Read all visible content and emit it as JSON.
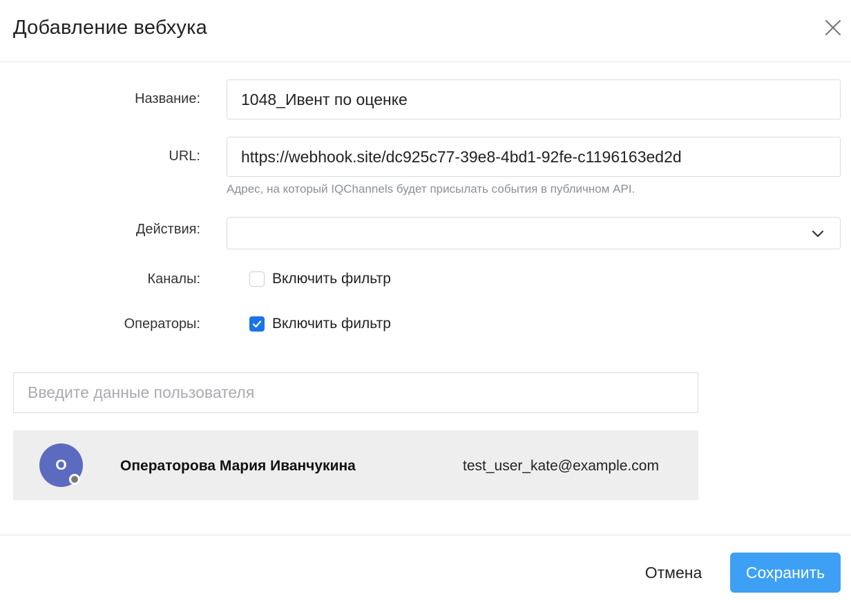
{
  "dialog": {
    "title": "Добавление вебхука",
    "close_icon": "close-icon"
  },
  "form": {
    "name": {
      "label": "Название:",
      "value": "1048_Ивент по оценке"
    },
    "url": {
      "label": "URL:",
      "value": "https://webhook.site/dc925c77-39e8-4bd1-92fe-c1196163ed2d",
      "hint": "Адрес, на который IQChannels будет присылать события в публичном API."
    },
    "actions": {
      "label": "Действия:",
      "selected": "",
      "icon": "chevron-down-icon"
    },
    "channels": {
      "label": "Каналы:",
      "checkbox_label": "Включить фильтр",
      "checked": false
    },
    "operators": {
      "label": "Операторы:",
      "checkbox_label": "Включить фильтр",
      "checked": true
    }
  },
  "user_search": {
    "placeholder": "Введите данные пользователя",
    "value": ""
  },
  "users": [
    {
      "avatar_letter": "О",
      "name": "Операторова Мария Иванчукина",
      "email": "test_user_kate@example.com",
      "status": "offline"
    }
  ],
  "footer": {
    "cancel_label": "Отмена",
    "save_label": "Сохранить"
  },
  "colors": {
    "primary": "#3da0f5",
    "checkbox_checked": "#1a73e8",
    "avatar": "#5c6bc0",
    "row_highlight": "#eeeeee",
    "hint": "#8a8f99"
  }
}
